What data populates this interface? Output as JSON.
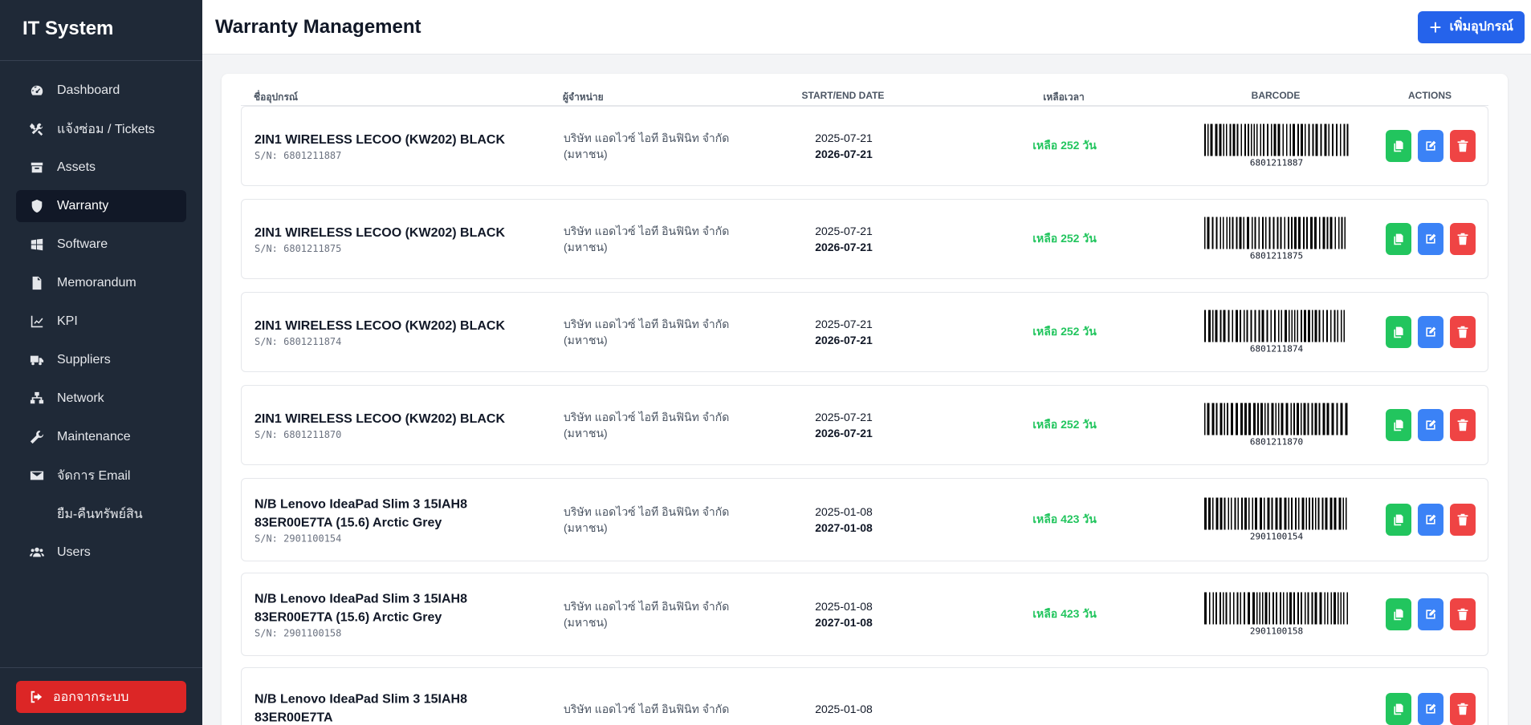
{
  "app": {
    "title": "IT System"
  },
  "sidebar": {
    "items": [
      {
        "label": "Dashboard",
        "icon": "dashboard-gauge-icon"
      },
      {
        "label": "แจ้งซ่อม / Tickets",
        "icon": "tools-icon"
      },
      {
        "label": "Assets",
        "icon": "archive-box-icon"
      },
      {
        "label": "Warranty",
        "icon": "shield-icon",
        "active": true
      },
      {
        "label": "Software",
        "icon": "windows-icon"
      },
      {
        "label": "Memorandum",
        "icon": "document-icon"
      },
      {
        "label": "KPI",
        "icon": "line-chart-icon"
      },
      {
        "label": "Suppliers",
        "icon": "truck-icon"
      },
      {
        "label": "Network",
        "icon": "network-icon"
      },
      {
        "label": "Maintenance",
        "icon": "wrench-icon"
      },
      {
        "label": "จัดการ Email",
        "icon": "envelope-icon"
      },
      {
        "label": "ยืม-คืนทรัพย์สิน",
        "icon": ""
      },
      {
        "label": "Users",
        "icon": "users-icon"
      }
    ],
    "logout_label": "ออกจากระบบ"
  },
  "header": {
    "title": "Warranty Management",
    "add_label": "เพิ่มอุปกรณ์"
  },
  "table": {
    "columns": {
      "name": "ชื่ออุปกรณ์",
      "vendor": "ผู้จำหน่าย",
      "dates": "START/END DATE",
      "remaining": "เหลือเวลา",
      "barcode": "BARCODE",
      "actions": "ACTIONS"
    },
    "rows": [
      {
        "name": "2IN1 WIRELESS LECOO (KW202) BLACK",
        "sn": "S/N: 6801211887",
        "vendor": "บริษัท แอดไวซ์ ไอที อินฟินิท จำกัด (มหาชน)",
        "start": "2025-07-21",
        "end": "2026-07-21",
        "remaining": "เหลือ 252 วัน",
        "barcode": "6801211887"
      },
      {
        "name": "2IN1 WIRELESS LECOO (KW202) BLACK",
        "sn": "S/N: 6801211875",
        "vendor": "บริษัท แอดไวซ์ ไอที อินฟินิท จำกัด (มหาชน)",
        "start": "2025-07-21",
        "end": "2026-07-21",
        "remaining": "เหลือ 252 วัน",
        "barcode": "6801211875"
      },
      {
        "name": "2IN1 WIRELESS LECOO (KW202) BLACK",
        "sn": "S/N: 6801211874",
        "vendor": "บริษัท แอดไวซ์ ไอที อินฟินิท จำกัด (มหาชน)",
        "start": "2025-07-21",
        "end": "2026-07-21",
        "remaining": "เหลือ 252 วัน",
        "barcode": "6801211874"
      },
      {
        "name": "2IN1 WIRELESS LECOO (KW202) BLACK",
        "sn": "S/N: 6801211870",
        "vendor": "บริษัท แอดไวซ์ ไอที อินฟินิท จำกัด (มหาชน)",
        "start": "2025-07-21",
        "end": "2026-07-21",
        "remaining": "เหลือ 252 วัน",
        "barcode": "6801211870"
      },
      {
        "name": "N/B Lenovo IdeaPad Slim 3 15IAH8 83ER00E7TA (15.6) Arctic Grey",
        "sn": "S/N: 2901100154",
        "vendor": "บริษัท แอดไวซ์ ไอที อินฟินิท จำกัด (มหาชน)",
        "start": "2025-01-08",
        "end": "2027-01-08",
        "remaining": "เหลือ 423 วัน",
        "barcode": "2901100154"
      },
      {
        "name": "N/B Lenovo IdeaPad Slim 3 15IAH8 83ER00E7TA (15.6) Arctic Grey",
        "sn": "S/N: 2901100158",
        "vendor": "บริษัท แอดไวซ์ ไอที อินฟินิท จำกัด (มหาชน)",
        "start": "2025-01-08",
        "end": "2027-01-08",
        "remaining": "เหลือ 423 วัน",
        "barcode": "2901100158"
      },
      {
        "name": "N/B Lenovo IdeaPad Slim 3 15IAH8 83ER00E7TA",
        "sn": "",
        "vendor": "บริษัท แอดไวซ์ ไอที อินฟินิท จำกัด",
        "start": "2025-01-08",
        "end": "",
        "remaining": "",
        "barcode": ""
      }
    ]
  },
  "colors": {
    "sidebar_bg": "#1f2937",
    "primary": "#2563eb",
    "danger": "#dc2626",
    "success": "#22c55e"
  }
}
